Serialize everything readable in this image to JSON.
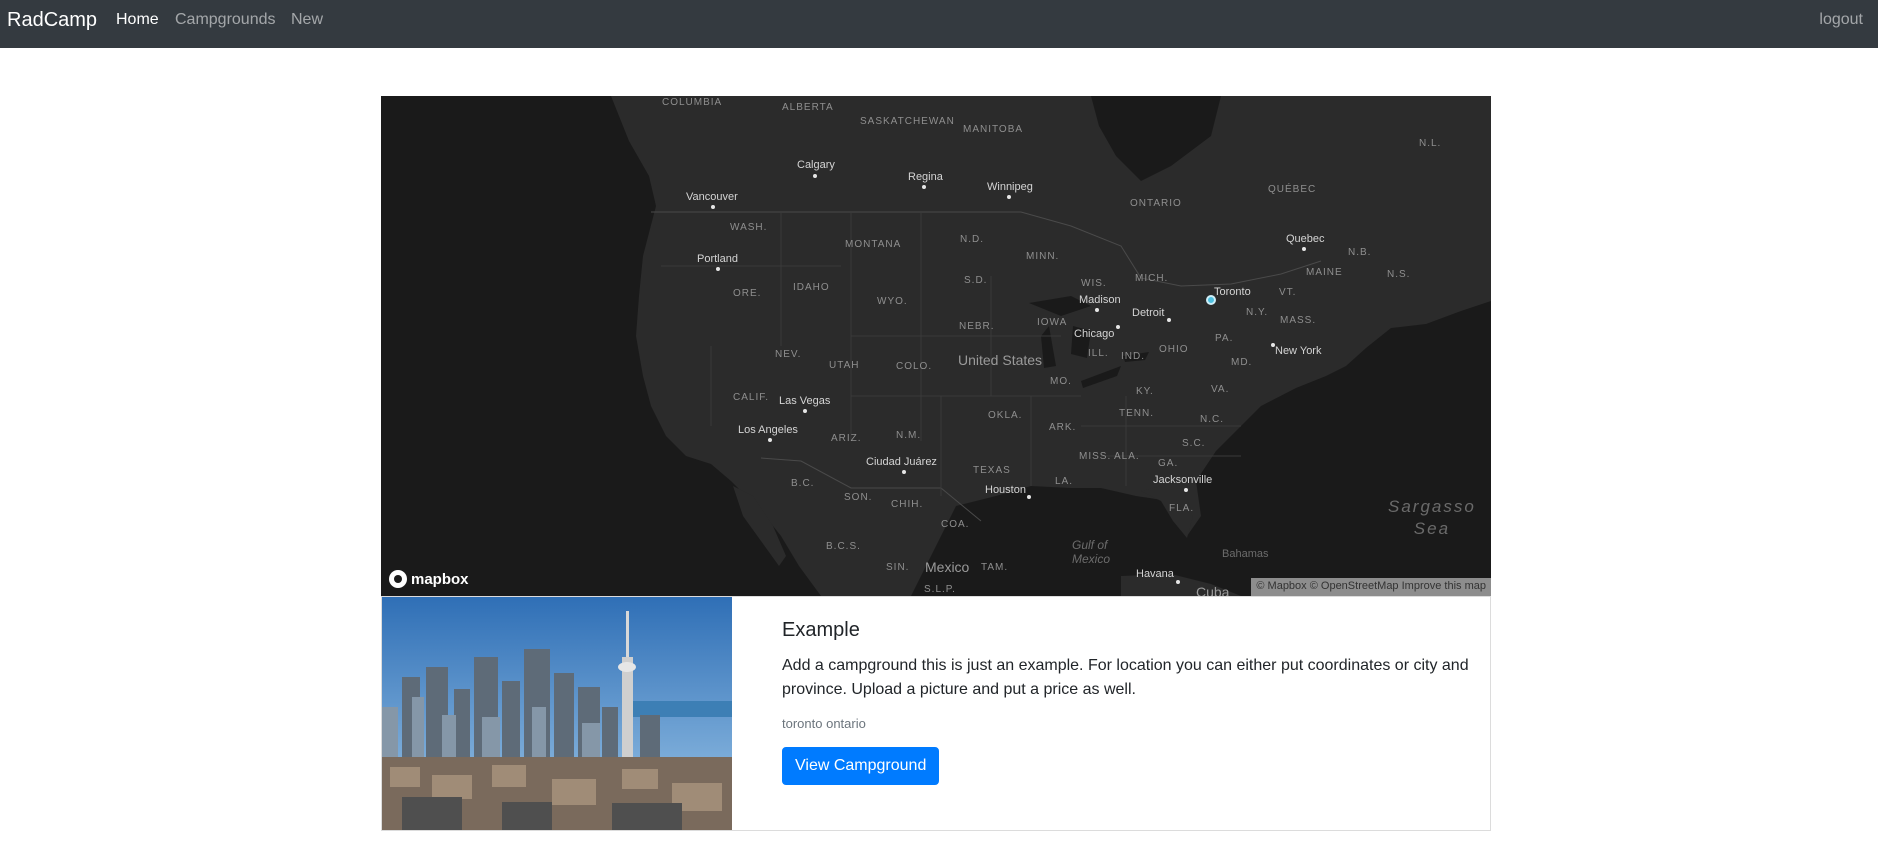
{
  "navbar": {
    "brand": "RadCamp",
    "links": [
      {
        "label": "Home",
        "active": true
      },
      {
        "label": "Campgrounds",
        "active": false
      },
      {
        "label": "New",
        "active": false
      }
    ],
    "logout_label": "logout"
  },
  "map": {
    "region_labels": [
      "COLUMBIA",
      "ALBERTA",
      "SASKATCHEWAN",
      "MANITOBA",
      "ONTARIO",
      "QUÉBEC",
      "N.L.",
      "WASH.",
      "MONTANA",
      "N.D.",
      "MINN.",
      "N.B.",
      "MAINE",
      "N.S.",
      "ORE.",
      "IDAHO",
      "WYO.",
      "S.D.",
      "WIS.",
      "MICH.",
      "VT.",
      "N.Y.",
      "NEBR.",
      "IOWA",
      "MASS.",
      "NEV.",
      "UTAH",
      "COLO.",
      "ILL.",
      "IND.",
      "OHIO",
      "PA.",
      "MD.",
      "MO.",
      "KY.",
      "VA.",
      "CALIF.",
      "OKLA.",
      "ARK.",
      "TENN.",
      "N.C.",
      "ARIZ.",
      "N.M.",
      "S.C.",
      "MISS.",
      "ALA.",
      "GA.",
      "TEXAS",
      "LA.",
      "B.C.",
      "SON.",
      "CHIH.",
      "FLA.",
      "COA.",
      "B.C.S.",
      "SIN.",
      "TAM.",
      "S.L.P."
    ],
    "cities": [
      "Calgary",
      "Regina",
      "Winnipeg",
      "Vancouver",
      "Quebec",
      "Portland",
      "Madison",
      "Toronto",
      "Detroit",
      "Chicago",
      "New York",
      "Las Vegas",
      "Los Angeles",
      "Ciudad Juárez",
      "Houston",
      "Jacksonville",
      "Havana"
    ],
    "country_labels": [
      "United States",
      "Mexico",
      "Cuba"
    ],
    "water_labels": {
      "gulf": [
        "Gulf of",
        "Mexico"
      ],
      "sargasso": [
        "Sargasso",
        "Sea"
      ],
      "bahamas": "Bahamas"
    },
    "logo_text": "mapbox",
    "attribution": {
      "mapbox": "© Mapbox",
      "osm": "© OpenStreetMap",
      "improve": "Improve this map"
    },
    "marker_label": "Toronto"
  },
  "campground": {
    "title": "Example",
    "description": "Add a campground this is just an example. For location you can either put coordinates or city and province. Upload a picture and put a price as well.",
    "location": "toronto ontario",
    "button_label": "View Campground"
  },
  "colors": {
    "navbar_bg": "#343a40",
    "map_bg": "#1a1a1a",
    "land": "#2b2b2b",
    "primary": "#007bff",
    "marker": "#4ec0e0"
  }
}
